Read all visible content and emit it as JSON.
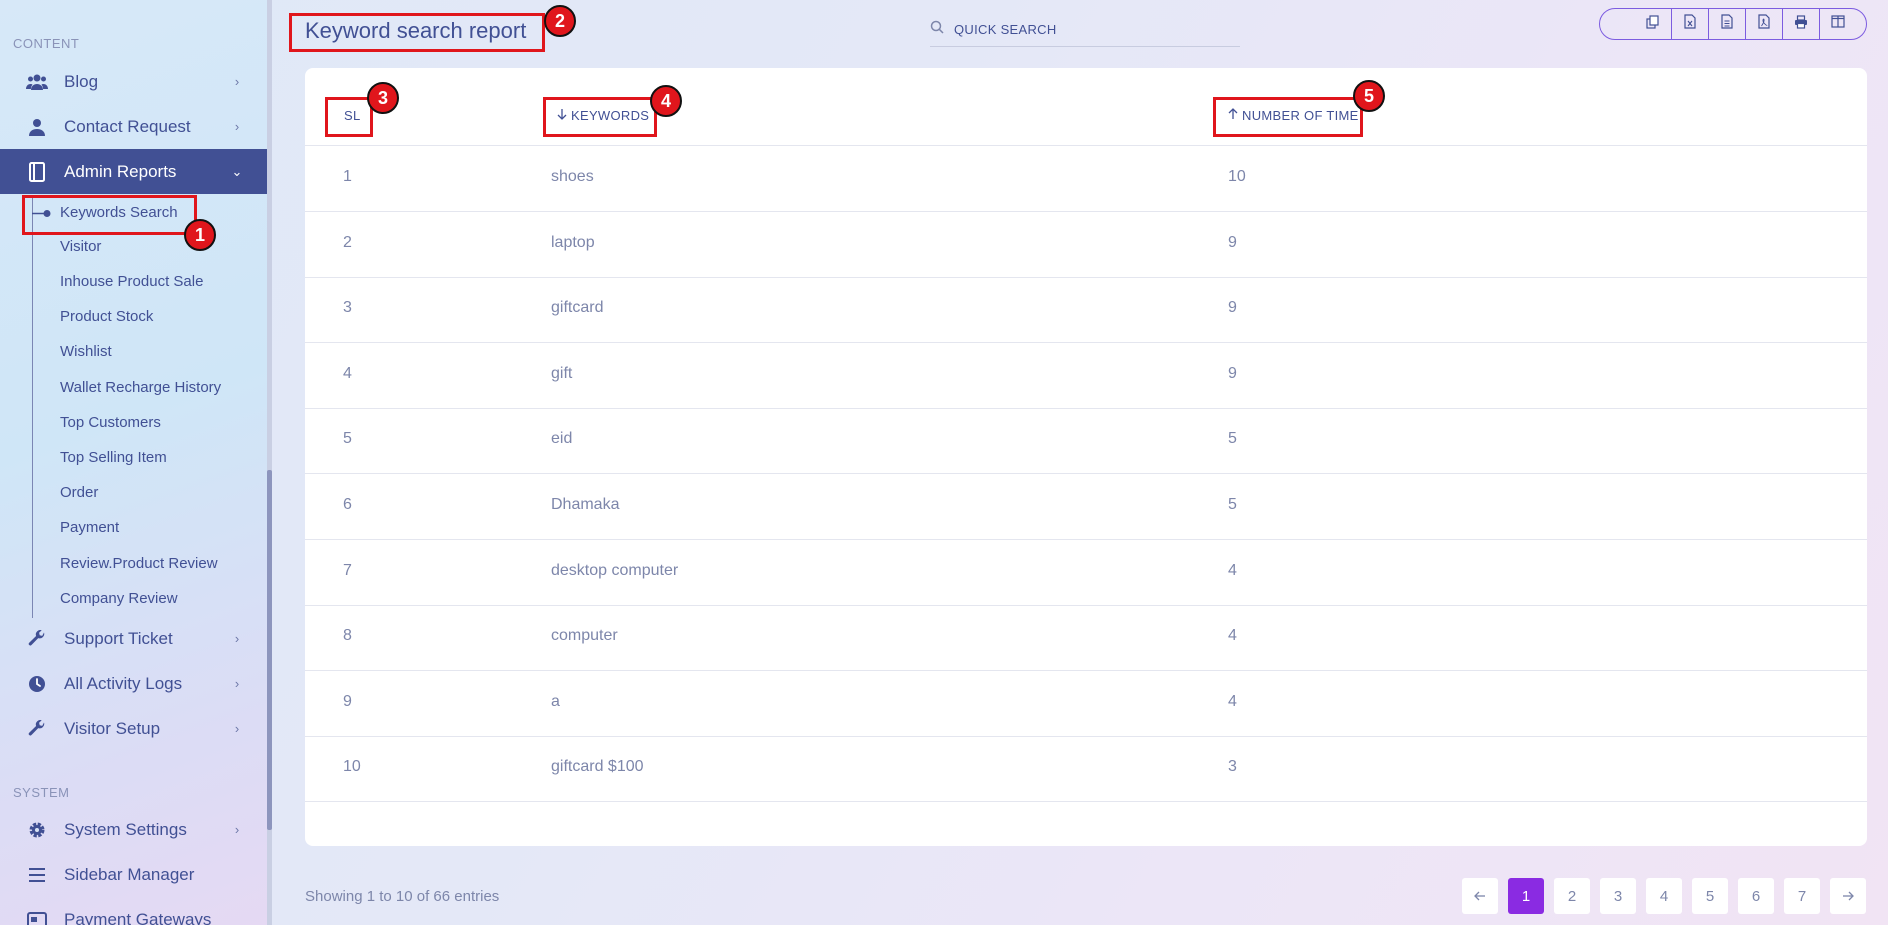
{
  "sidebar": {
    "section_content": "CONTENT",
    "section_system": "SYSTEM",
    "items": [
      {
        "label": "Blog",
        "icon": "users-icon"
      },
      {
        "label": "Contact Request",
        "icon": "user-icon"
      },
      {
        "label": "Admin Reports",
        "icon": "book-icon"
      },
      {
        "label": "Support Ticket",
        "icon": "wrench-icon"
      },
      {
        "label": "All Activity Logs",
        "icon": "clock-icon"
      },
      {
        "label": "Visitor Setup",
        "icon": "wrench-icon"
      },
      {
        "label": "System Settings",
        "icon": "gear-icon"
      },
      {
        "label": "Sidebar Manager",
        "icon": "menu-icon"
      },
      {
        "label": "Payment Gateways",
        "icon": "card-icon"
      }
    ],
    "submenu": [
      "Keywords Search",
      "Visitor",
      "Inhouse Product Sale",
      "Product Stock",
      "Wishlist",
      "Wallet Recharge History",
      "Top Customers",
      "Top Selling Item",
      "Order",
      "Payment",
      "Review.Product Review",
      "Company Review"
    ]
  },
  "header": {
    "title": "Keyword search report",
    "search_placeholder": "QUICK SEARCH",
    "toolbar": [
      "copy-icon",
      "excel-icon",
      "csv-icon",
      "pdf-icon",
      "print-icon",
      "columns-icon"
    ]
  },
  "table": {
    "headers": [
      "SL",
      "KEYWORDS",
      "NUMBER OF TIME"
    ],
    "rows": [
      {
        "sl": "1",
        "keyword": "shoes",
        "count": "10"
      },
      {
        "sl": "2",
        "keyword": "laptop",
        "count": "9"
      },
      {
        "sl": "3",
        "keyword": "giftcard",
        "count": "9"
      },
      {
        "sl": "4",
        "keyword": "gift",
        "count": "9"
      },
      {
        "sl": "5",
        "keyword": "eid",
        "count": "5"
      },
      {
        "sl": "6",
        "keyword": "Dhamaka",
        "count": "5"
      },
      {
        "sl": "7",
        "keyword": "desktop computer",
        "count": "4"
      },
      {
        "sl": "8",
        "keyword": "computer",
        "count": "4"
      },
      {
        "sl": "9",
        "keyword": "a",
        "count": "4"
      },
      {
        "sl": "10",
        "keyword": "giftcard $100",
        "count": "3"
      }
    ]
  },
  "footer": {
    "entries_text": "Showing 1 to 10 of 66 entries",
    "pages": [
      "1",
      "2",
      "3",
      "4",
      "5",
      "6",
      "7"
    ],
    "current_page": "1"
  },
  "annotations": [
    "1",
    "2",
    "3",
    "4",
    "5"
  ],
  "colors": {
    "accent": "#415094",
    "active_page": "#8a2be2",
    "annotation": "#e0161c"
  }
}
